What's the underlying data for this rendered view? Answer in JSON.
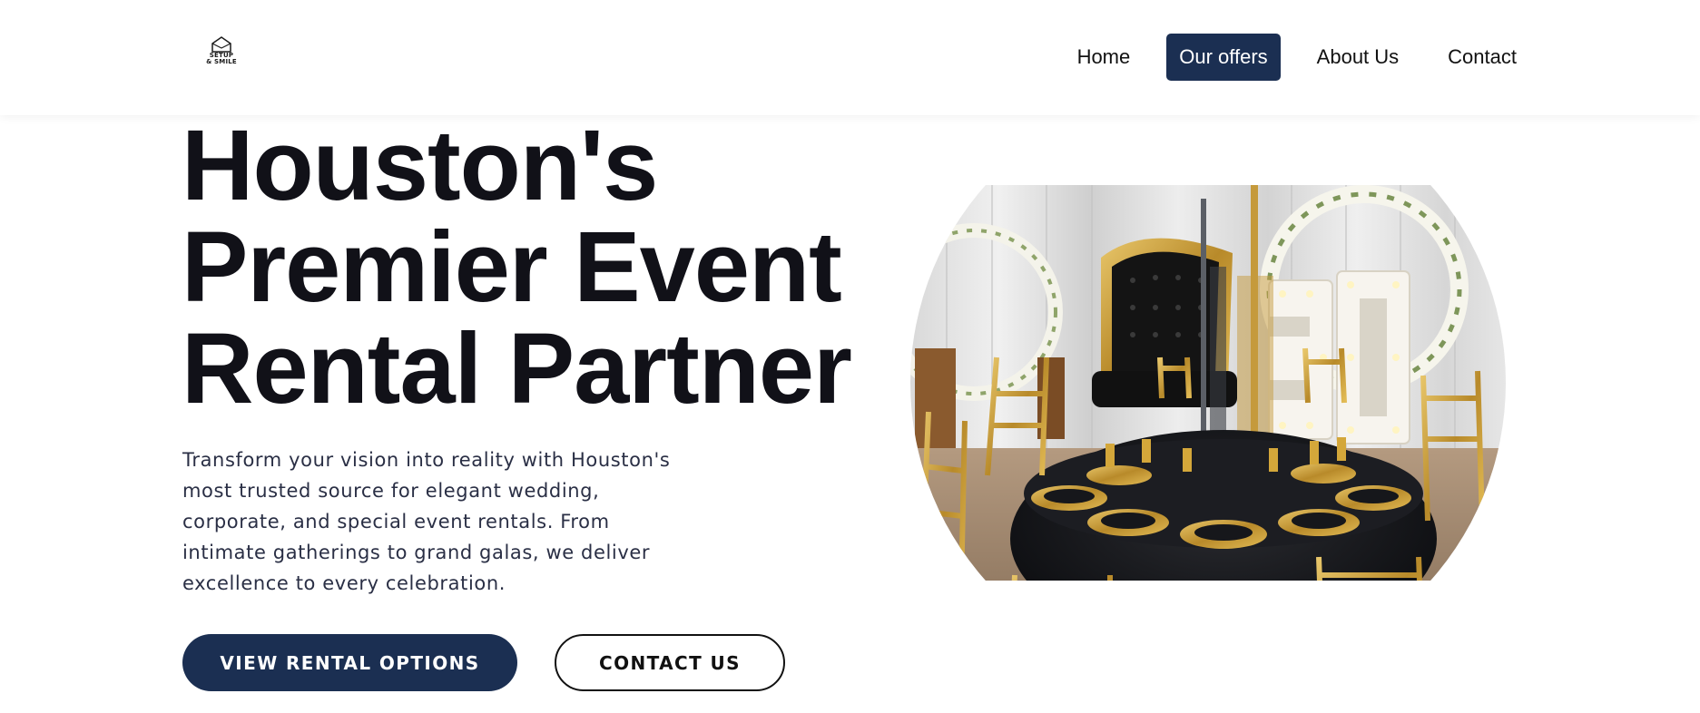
{
  "header": {
    "logo": {
      "text": "SETUP\n& SMILE",
      "icon": "house-icon"
    },
    "nav": [
      {
        "label": "Home",
        "active": false
      },
      {
        "label": "Our offers",
        "active": true
      },
      {
        "label": "About Us",
        "active": false
      },
      {
        "label": "Contact",
        "active": false
      }
    ]
  },
  "hero": {
    "title_lines": [
      "Houston's",
      "Premier Event",
      "Rental Partner"
    ],
    "description": "Transform your vision into reality with Houston's most trusted source for elegant wedding, corporate, and special event rentals. From intimate gatherings to grand galas, we deliver excellence to every celebration.",
    "primary_button": "VIEW RENTAL OPTIONS",
    "secondary_button": "CONTACT US",
    "image": {
      "icon": "event-table-photo"
    }
  },
  "colors": {
    "brand_navy": "#1b2f52",
    "title": "#111118",
    "body_text": "#2a2f45",
    "gold": "#c9a227",
    "tablecloth": "#15161a"
  }
}
